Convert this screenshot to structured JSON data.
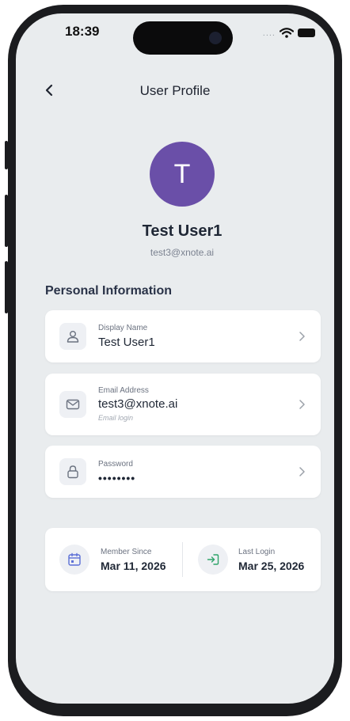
{
  "status_bar": {
    "time": "18:39",
    "signal": "....",
    "battery_color": "#111111"
  },
  "nav": {
    "back_icon": "chevron-left-icon",
    "title": "User Profile"
  },
  "profile": {
    "avatar_initial": "T",
    "avatar_color": "#6a4fa8",
    "name": "Test User1",
    "email": "test3@xnote.ai"
  },
  "personal_info": {
    "section_title": "Personal Information",
    "fields": [
      {
        "icon": "user-icon",
        "label": "Display Name",
        "value": "Test User1"
      },
      {
        "icon": "mail-icon",
        "label": "Email Address",
        "value": "test3@xnote.ai",
        "sub": "Email login"
      },
      {
        "icon": "lock-icon",
        "label": "Password",
        "value": "••••••••"
      }
    ]
  },
  "stats": {
    "member_since": {
      "icon": "calendar-icon",
      "label": "Member Since",
      "value": "Mar 11, 2026",
      "icon_color": "#5b6fd6"
    },
    "last_login": {
      "icon": "login-icon",
      "label": "Last Login",
      "value": "Mar 25, 2026",
      "icon_color": "#2ea46a"
    }
  }
}
